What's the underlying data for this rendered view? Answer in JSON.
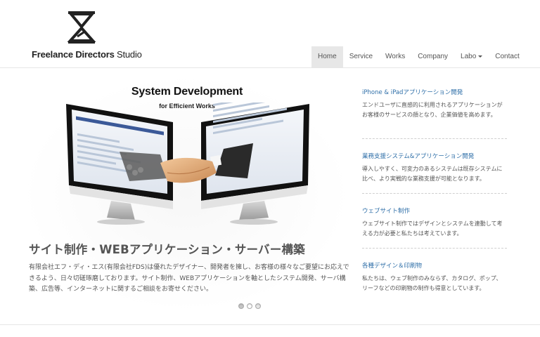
{
  "logo": {
    "brand_bold": "Freelance Directors",
    "brand_light": "Studio"
  },
  "nav": {
    "items": [
      {
        "label": "Home",
        "active": true
      },
      {
        "label": "Service"
      },
      {
        "label": "Works"
      },
      {
        "label": "Company"
      },
      {
        "label": "Labo",
        "dropdown": true
      },
      {
        "label": "Contact"
      }
    ]
  },
  "slider": {
    "title": "System Development",
    "subtitle": "for Efficient Works",
    "slide_count": 3,
    "active_index": 0
  },
  "main": {
    "title": "サイト制作・WEBアプリケーション・サーバー構築",
    "body": "有限会社エフ・ディ・エス(有限会社FDS)は優れたデザイナー、開発者を擁し、お客様の様々なご要望にお応えできるよう、日々切磋琢磨しております。サイト制作、WEBアプリケーションを軸としたシステム開発、サーバ構築、広告等、インターネットに関する",
    "link_text": "ご相談をお寄せください。"
  },
  "services": [
    {
      "title": "iPhone & iPadアプリケーション開発",
      "text": "エンドユーザに直感的に利用されるアプリケーションがお客様のサービスの顔となり、企業価値を高めます。"
    },
    {
      "title": "業務支援システム&アプリケーション開発",
      "text": "導入しやすく、可変力のあるシステムは既存システムに比べ、より実戦的な業務支援が可能となります。"
    },
    {
      "title": "ウェブサイト制作",
      "text": "ウェブサイト制作ではデザインとシステムを連動して考える力が必要と私たちは考えています。"
    },
    {
      "title": "各種デザイン＆印刷物",
      "text": "私たちは、ウェブ制作のみならず、カタログ、ポップ、リーフなどの印刷物の制作も得意としています。"
    }
  ],
  "colors": {
    "link": "#2f6fa8",
    "nav_active_bg": "#e7e7e7",
    "text": "#555555"
  }
}
